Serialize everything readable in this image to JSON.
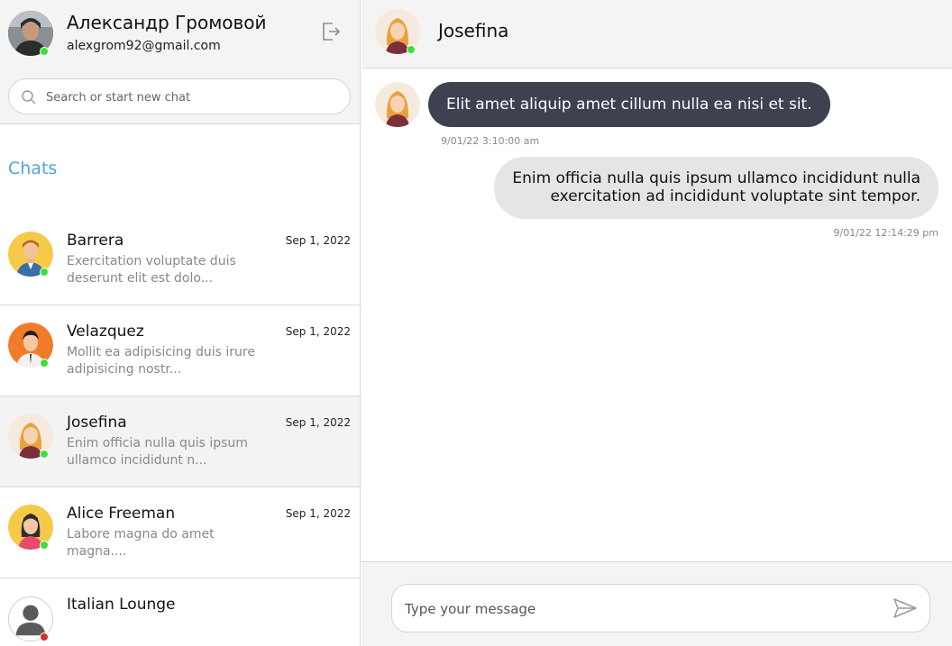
{
  "profile": {
    "name": "Александр Громовой",
    "email": "alexgrom92@gmail.com"
  },
  "search": {
    "placeholder": "Search or start new chat"
  },
  "sidebar": {
    "chats_title": "Chats",
    "chats": [
      {
        "name": "Barrera",
        "date": "Sep 1, 2022",
        "preview": "Exercitation voluptate duis deserunt elit est dolo...",
        "status": "online"
      },
      {
        "name": "Velazquez",
        "date": "Sep 1, 2022",
        "preview": "Mollit ea adipisicing duis irure adipisicing nostr...",
        "status": "online"
      },
      {
        "name": "Josefina",
        "date": "Sep 1, 2022",
        "preview": "Enim officia nulla quis ipsum ullamco incididunt n...",
        "status": "online"
      },
      {
        "name": "Alice Freeman",
        "date": "Sep 1, 2022",
        "preview": "Labore magna do amet magna....",
        "status": "online"
      },
      {
        "name": "Italian Lounge",
        "date": "",
        "preview": "",
        "status": "offline"
      }
    ]
  },
  "conversation": {
    "contact_name": "Josefina",
    "messages": [
      {
        "direction": "in",
        "text": "Elit amet aliquip amet cillum nulla ea nisi et sit.",
        "time": "9/01/22 3:10:00 am"
      },
      {
        "direction": "out",
        "text": "Enim officia nulla quis ipsum ullamco incididunt nulla exercitation ad incididunt voluptate sint tempor.",
        "time": "9/01/22 12:14:29 pm"
      }
    ]
  },
  "composer": {
    "placeholder": "Type your message"
  },
  "colors": {
    "accent": "#4ea6d3",
    "incoming_bubble": "#3d4150",
    "outgoing_bubble": "#e5e5e5",
    "online": "#3adf3a",
    "offline": "#d32f2f"
  }
}
